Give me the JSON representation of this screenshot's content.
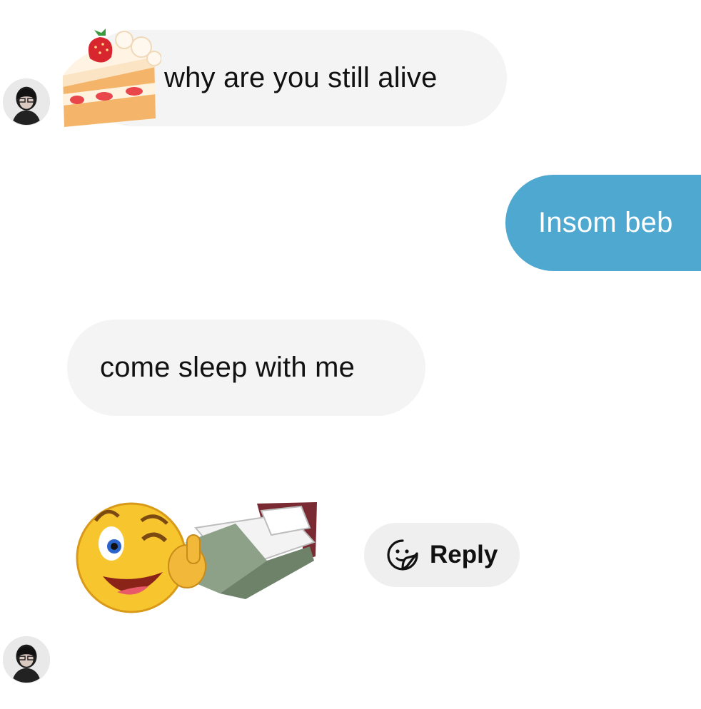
{
  "conversation": {
    "messages": [
      {
        "from": "them",
        "text": "why are you still alive",
        "sticker": "strawberry-shortcake-icon"
      },
      {
        "from": "me",
        "text": "Insom beb"
      },
      {
        "from": "them",
        "text": "come sleep with me"
      },
      {
        "from": "them",
        "sticker": "winking-emoji-in-bed-sticker"
      }
    ],
    "reply_button": {
      "label": "Reply",
      "icon": "sticker-reply-icon"
    }
  },
  "colors": {
    "incoming_bubble": "#f4f4f4",
    "outgoing_bubble": "#4fa8cf",
    "reply_button_bg": "#efefef"
  }
}
